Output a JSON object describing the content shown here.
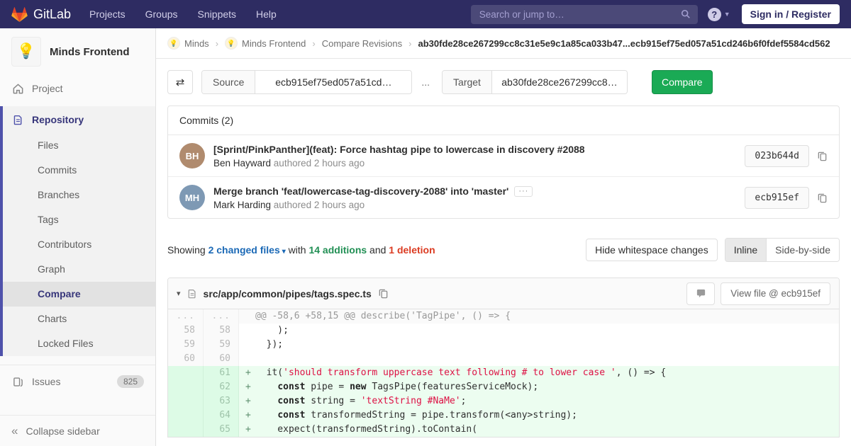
{
  "colors": {
    "navbar": "#2e2c62",
    "accent_green": "#1aaa55",
    "link_blue": "#1b69b6",
    "addition_green": "#218f54",
    "deletion_red": "#db3b21",
    "active_indigo": "#4f52ab"
  },
  "icons": {
    "swap": "⇄",
    "caret_down": "▾",
    "ellipsis": "···",
    "separator": "›",
    "bulb": "💡",
    "help": "?",
    "collapse": "«",
    "chevron_down": "⌄"
  },
  "navbar": {
    "brand": "GitLab",
    "menu": [
      "Projects",
      "Groups",
      "Snippets",
      "Help"
    ],
    "search_placeholder": "Search or jump to…",
    "sign_in": "Sign in / Register"
  },
  "sidebar": {
    "project_name": "Minds Frontend",
    "project_item": "Project",
    "repository_item": "Repository",
    "repo_subitems": [
      "Files",
      "Commits",
      "Branches",
      "Tags",
      "Contributors",
      "Graph",
      "Compare",
      "Charts",
      "Locked Files"
    ],
    "active_subitem": "Compare",
    "issues_label": "Issues",
    "issues_count": "825",
    "collapse_label": "Collapse sidebar"
  },
  "breadcrumb": {
    "items": [
      {
        "label": "Minds",
        "avatar": true
      },
      {
        "label": "Minds Frontend",
        "avatar": true
      },
      {
        "label": "Compare Revisions",
        "avatar": false
      }
    ],
    "current": "ab30fde28ce267299cc8c31e5e9c1a85ca033b47...ecb915ef75ed057a51cd246b6f0fdef5584cd562"
  },
  "compare_form": {
    "source_label": "Source",
    "source_value": "ecb915ef75ed057a51cd…",
    "separator": "...",
    "target_label": "Target",
    "target_value": "ab30fde28ce267299cc8…",
    "compare_button": "Compare"
  },
  "commits": {
    "header": "Commits (2)",
    "items": [
      {
        "title": "[Sprint/PinkPanther](feat): Force hashtag pipe to lowercase in discovery #2088",
        "author": "Ben Hayward",
        "authored": "authored 2 hours ago",
        "sha": "023b644d",
        "initials": "BH",
        "avatar_color": "#b08b6e",
        "has_ellipsis": false
      },
      {
        "title": "Merge branch 'feat/lowercase-tag-discovery-2088' into 'master'",
        "author": "Mark Harding",
        "authored": "authored 2 hours ago",
        "sha": "ecb915ef",
        "initials": "MH",
        "avatar_color": "#7e99b4",
        "has_ellipsis": true
      }
    ]
  },
  "diff_summary": {
    "showing": "Showing",
    "files_link": "2 changed files",
    "with": "with",
    "additions": "14 additions",
    "and": "and",
    "deletions": "1 deletion",
    "hide_whitespace": "Hide whitespace changes",
    "view_modes": [
      "Inline",
      "Side-by-side"
    ],
    "active_mode": "Inline"
  },
  "diff_file": {
    "path": "src/app/common/pipes/tags.spec.ts",
    "view_file": "View file @ ecb915ef",
    "lines": [
      {
        "type": "match",
        "old": "...",
        "new": "...",
        "prefix": "",
        "segs": [
          {
            "c": "p",
            "t": "@@ -58,6 +58,15 @@ describe('TagPipe', () => {"
          }
        ]
      },
      {
        "type": "context",
        "old": "58",
        "new": "58",
        "prefix": "",
        "segs": [
          {
            "c": "p",
            "t": "    );"
          }
        ]
      },
      {
        "type": "context",
        "old": "59",
        "new": "59",
        "prefix": "",
        "segs": [
          {
            "c": "p",
            "t": "  });"
          }
        ]
      },
      {
        "type": "context",
        "old": "60",
        "new": "60",
        "prefix": "",
        "segs": []
      },
      {
        "type": "add",
        "old": "",
        "new": "61",
        "prefix": "+",
        "segs": [
          {
            "c": "p",
            "t": "  it("
          },
          {
            "c": "s",
            "t": "'should transform uppercase text following # to lower case '"
          },
          {
            "c": "p",
            "t": ", () => {"
          }
        ]
      },
      {
        "type": "add",
        "old": "",
        "new": "62",
        "prefix": "+",
        "segs": [
          {
            "c": "p",
            "t": "    "
          },
          {
            "c": "k",
            "t": "const"
          },
          {
            "c": "p",
            "t": " pipe = "
          },
          {
            "c": "k",
            "t": "new"
          },
          {
            "c": "p",
            "t": " TagsPipe(featuresServiceMock);"
          }
        ]
      },
      {
        "type": "add",
        "old": "",
        "new": "63",
        "prefix": "+",
        "segs": [
          {
            "c": "p",
            "t": "    "
          },
          {
            "c": "k",
            "t": "const"
          },
          {
            "c": "p",
            "t": " string = "
          },
          {
            "c": "s",
            "t": "'textString #NaMe'"
          },
          {
            "c": "p",
            "t": ";"
          }
        ]
      },
      {
        "type": "add",
        "old": "",
        "new": "64",
        "prefix": "+",
        "segs": [
          {
            "c": "p",
            "t": "    "
          },
          {
            "c": "k",
            "t": "const"
          },
          {
            "c": "p",
            "t": " transformedString = pipe.transform(<any>string);"
          }
        ]
      },
      {
        "type": "add",
        "old": "",
        "new": "65",
        "prefix": "+",
        "segs": [
          {
            "c": "p",
            "t": "    expect(transformedString).toContain("
          }
        ]
      }
    ]
  }
}
